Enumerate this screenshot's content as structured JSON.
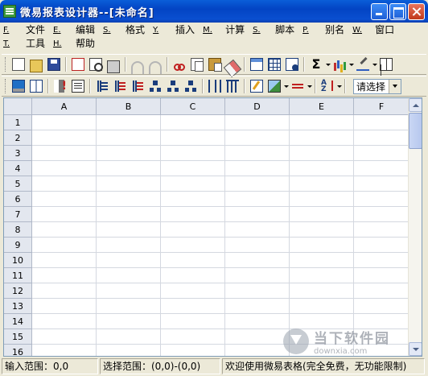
{
  "window": {
    "title": "微易报表设计器--[未命名]"
  },
  "menu": [
    {
      "accel": "F.",
      "label": "文件"
    },
    {
      "accel": "E.",
      "label": "编辑"
    },
    {
      "accel": "S.",
      "label": "格式"
    },
    {
      "accel": "Y.",
      "label": "插入"
    },
    {
      "accel": "M.",
      "label": "计算"
    },
    {
      "accel": "S.",
      "label": "脚本"
    },
    {
      "accel": "P.",
      "label": "别名"
    },
    {
      "accel": "W.",
      "label": "窗口"
    },
    {
      "accel": "T.",
      "label": "工具"
    },
    {
      "accel": "H.",
      "label": "帮助"
    }
  ],
  "toolbar": {
    "selector_value": "请选择"
  },
  "grid": {
    "columns": [
      "A",
      "B",
      "C",
      "D",
      "E",
      "F"
    ],
    "rows": [
      "1",
      "2",
      "3",
      "4",
      "5",
      "6",
      "7",
      "8",
      "9",
      "10",
      "11",
      "12",
      "13",
      "14",
      "15",
      "16"
    ]
  },
  "status": {
    "input_range": "输入范围：0,0",
    "select_range": "选择范围：(0,0)-(0,0)",
    "message": "欢迎使用微易表格(完全免费，无功能限制)"
  },
  "watermark": {
    "cn": "当下软件园",
    "en": "downxia.com"
  }
}
